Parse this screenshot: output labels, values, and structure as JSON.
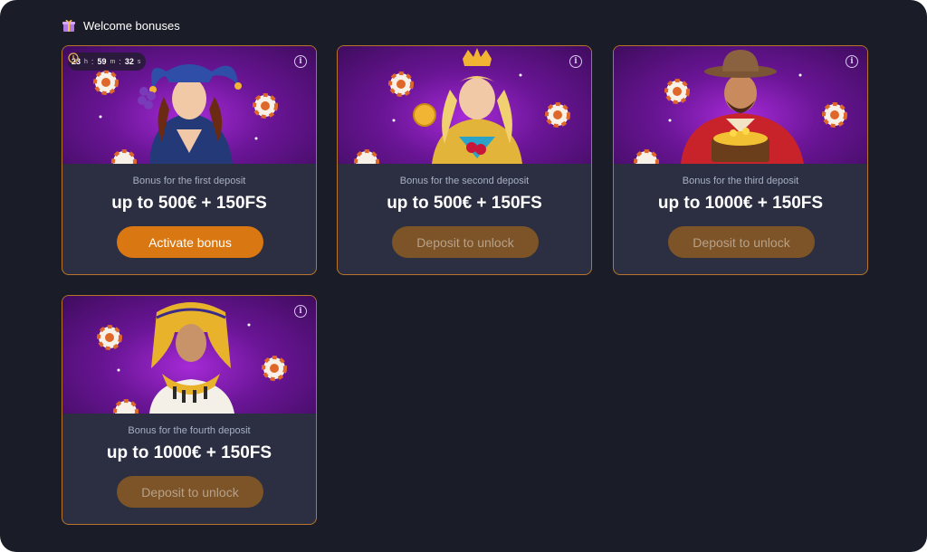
{
  "header": {
    "title": "Welcome bonuses",
    "icon": "gift-icon"
  },
  "timer": {
    "hours": "23",
    "h": "h",
    "minutes": "59",
    "m": "m",
    "seconds": "32",
    "s": "s",
    "sep": ":"
  },
  "cards": [
    {
      "subtitle": "Bonus for the first deposit",
      "amount": "up to 500€ + 150FS",
      "button": "Activate bonus",
      "state": "active",
      "art": "jester-woman-with-grapes"
    },
    {
      "subtitle": "Bonus for the second deposit",
      "amount": "up to 500€ + 150FS",
      "button": "Deposit to unlock",
      "state": "locked",
      "art": "queen-with-coin"
    },
    {
      "subtitle": "Bonus for the third deposit",
      "amount": "up to 1000€ + 150FS",
      "button": "Deposit to unlock",
      "state": "locked",
      "art": "cowboy-with-gold-chest"
    },
    {
      "subtitle": "Bonus for the fourth deposit",
      "amount": "up to 1000€ + 150FS",
      "button": "Deposit to unlock",
      "state": "locked",
      "art": "egyptian-queen"
    }
  ],
  "colors": {
    "accent": "#d97713",
    "locked_button": "#7d5427",
    "card_border": "#b8742a",
    "panel": "#1a1d27",
    "card": "#2b2f41"
  }
}
